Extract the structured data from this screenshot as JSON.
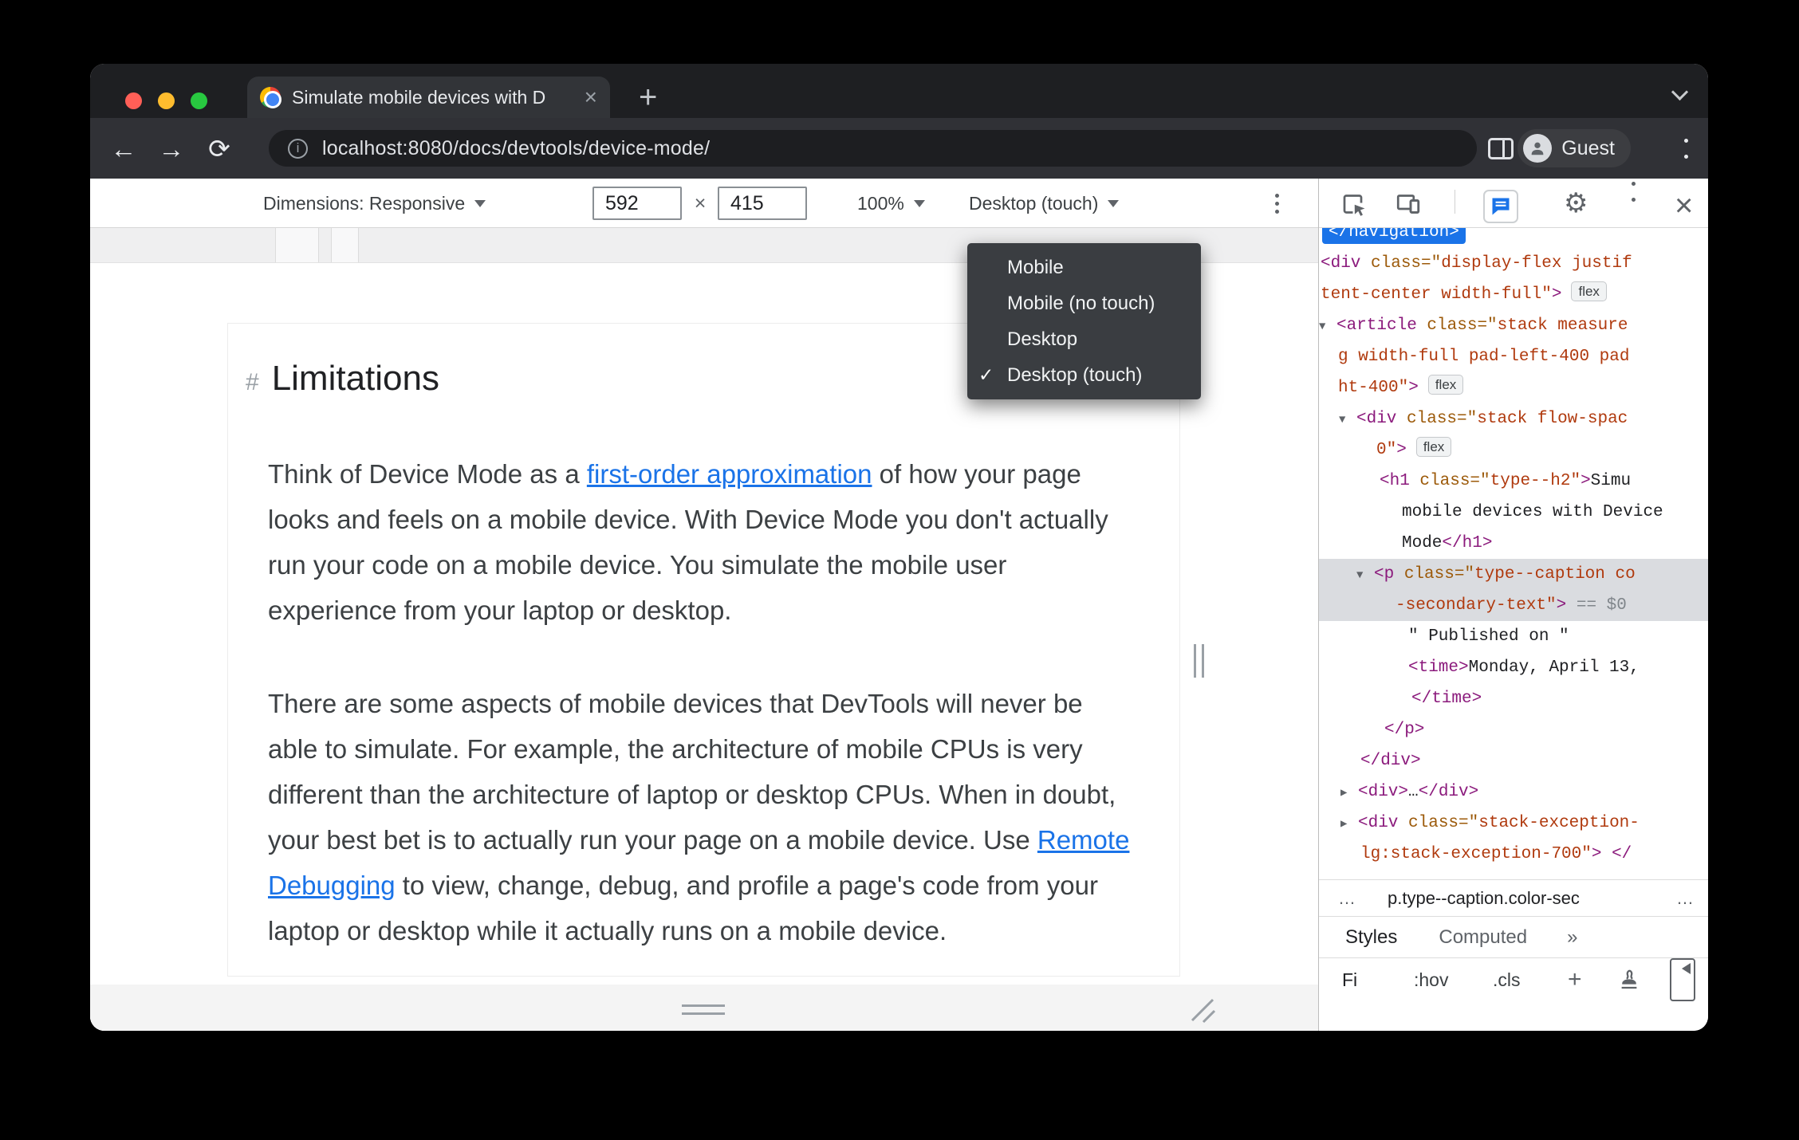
{
  "browser": {
    "tab_title": "Simulate mobile devices with D",
    "url": "localhost:8080/docs/devtools/device-mode/",
    "guest": "Guest"
  },
  "icons": {
    "tab_close": "×",
    "new_tab": "+",
    "gear": "⚙",
    "close": "×",
    "back": "←",
    "forward": "→",
    "reload": "⟳"
  },
  "device_toolbar": {
    "dimensions": "Dimensions: Responsive",
    "width": "592",
    "times": "×",
    "height": "415",
    "zoom": "100%",
    "device_type": "Desktop (touch)"
  },
  "device_menu": {
    "check": "✓",
    "items": [
      {
        "label": "Mobile",
        "checked": false
      },
      {
        "label": "Mobile (no touch)",
        "checked": false
      },
      {
        "label": "Desktop",
        "checked": false
      },
      {
        "label": "Desktop (touch)",
        "checked": true
      }
    ]
  },
  "article": {
    "hash": "#",
    "title": "Limitations",
    "p1": {
      "before": "Think of Device Mode as a ",
      "link": "first-order approximation",
      "after": " of how your page looks and feels on a mobile device. With Device Mode you don't actually run your code on a mobile device. You simulate the mobile user experience from your laptop or desktop."
    },
    "p2": {
      "before": "There are some aspects of mobile devices that DevTools will never be able to simulate. For example, the architecture of mobile CPUs is very different than the architecture of laptop or desktop CPUs. When in doubt, your best bet is to actually run your page on a mobile device. Use ",
      "link": "Remote Debugging",
      "after": " to view, change, debug, and profile a page's code from your laptop or desktop while it actually runs on a mobile device."
    }
  },
  "devtools": {
    "tree": [
      {
        "pad": 4,
        "sel": "blue",
        "tokens": [
          {
            "t": "tag",
            "s": "</navigation>"
          }
        ]
      },
      {
        "pad": 2,
        "tokens": [
          {
            "t": "tag",
            "s": "<div"
          },
          {
            "t": "attr",
            "s": " class=\""
          },
          {
            "t": "val",
            "s": "display-flex justif"
          }
        ]
      },
      {
        "pad": 2,
        "badge": "flex",
        "tokens": [
          {
            "t": "val",
            "s": "tent-center width-full\""
          },
          {
            "t": "tag",
            "s": ">"
          }
        ]
      },
      {
        "pad": 0,
        "tokens": [
          {
            "t": "arr",
            "s": "▼"
          },
          {
            "t": "tag",
            "s": "<article"
          },
          {
            "t": "attr",
            "s": " class=\""
          },
          {
            "t": "val",
            "s": "stack measure"
          }
        ]
      },
      {
        "pad": 24,
        "tokens": [
          {
            "t": "val",
            "s": "g width-full pad-left-400 pad"
          }
        ]
      },
      {
        "pad": 24,
        "badge": "flex",
        "tokens": [
          {
            "t": "val",
            "s": "ht-400\""
          },
          {
            "t": "tag",
            "s": ">"
          }
        ]
      },
      {
        "pad": 25,
        "tokens": [
          {
            "t": "arr",
            "s": "▼"
          },
          {
            "t": "tag",
            "s": "<div"
          },
          {
            "t": "attr",
            "s": " class=\""
          },
          {
            "t": "val",
            "s": "stack flow-spac"
          }
        ]
      },
      {
        "pad": 72,
        "badge": "flex",
        "tokens": [
          {
            "t": "val",
            "s": "0\""
          },
          {
            "t": "tag",
            "s": ">"
          }
        ]
      },
      {
        "pad": 76,
        "tokens": [
          {
            "t": "tag",
            "s": "<h1"
          },
          {
            "t": "attr",
            "s": " class=\""
          },
          {
            "t": "val",
            "s": "type--h2\""
          },
          {
            "t": "tag",
            "s": ">"
          },
          {
            "t": "txt",
            "s": "Simu"
          }
        ]
      },
      {
        "pad": 104,
        "tokens": [
          {
            "t": "txt",
            "s": "mobile devices with Device"
          }
        ]
      },
      {
        "pad": 104,
        "tokens": [
          {
            "t": "txt",
            "s": "Mode"
          },
          {
            "t": "tag",
            "s": "</h1>"
          }
        ]
      },
      {
        "pad": 47,
        "sel": "gray",
        "tokens": [
          {
            "t": "arr",
            "s": "▼"
          },
          {
            "t": "tag",
            "s": "<p"
          },
          {
            "t": "attr",
            "s": " class=\""
          },
          {
            "t": "val",
            "s": "type--caption co"
          }
        ]
      },
      {
        "pad": 96,
        "sel": "gray",
        "tokens": [
          {
            "t": "val",
            "s": "-secondary-text\""
          },
          {
            "t": "tag",
            "s": ">"
          },
          {
            "t": "gray",
            "s": " == $0"
          }
        ]
      },
      {
        "pad": 112,
        "tokens": [
          {
            "t": "txt",
            "s": "\" Published on \""
          }
        ]
      },
      {
        "pad": 112,
        "tokens": [
          {
            "t": "tag",
            "s": "<time>"
          },
          {
            "t": "txt",
            "s": "Monday, April 13,"
          }
        ]
      },
      {
        "pad": 116,
        "tokens": [
          {
            "t": "tag",
            "s": "</time>"
          }
        ]
      },
      {
        "pad": 82,
        "tokens": [
          {
            "t": "tag",
            "s": "</p>"
          }
        ]
      },
      {
        "pad": 52,
        "tokens": [
          {
            "t": "tag",
            "s": "</div>"
          }
        ]
      },
      {
        "pad": 27,
        "tokens": [
          {
            "t": "arr",
            "s": "▶"
          },
          {
            "t": "tag",
            "s": "<div>"
          },
          {
            "t": "txt",
            "s": "…"
          },
          {
            "t": "tag",
            "s": "</div>"
          }
        ]
      },
      {
        "pad": 27,
        "tokens": [
          {
            "t": "arr",
            "s": "▶"
          },
          {
            "t": "tag",
            "s": "<div"
          },
          {
            "t": "attr",
            "s": " class=\""
          },
          {
            "t": "val",
            "s": "stack-exception-"
          }
        ]
      },
      {
        "pad": 52,
        "tokens": [
          {
            "t": "val",
            "s": "lg:stack-exception-700\""
          },
          {
            "t": "tag",
            "s": "> </"
          }
        ]
      }
    ],
    "breadcrumb": {
      "left_more": "…",
      "crumb": "p.type--caption.color-sec",
      "right_more": "…"
    },
    "tabs": [
      "Styles",
      "Computed"
    ],
    "more_tabs": "»",
    "filter": {
      "text": "Fi",
      "hov": ":hov",
      "cls": ".cls",
      "plus": "+"
    }
  }
}
